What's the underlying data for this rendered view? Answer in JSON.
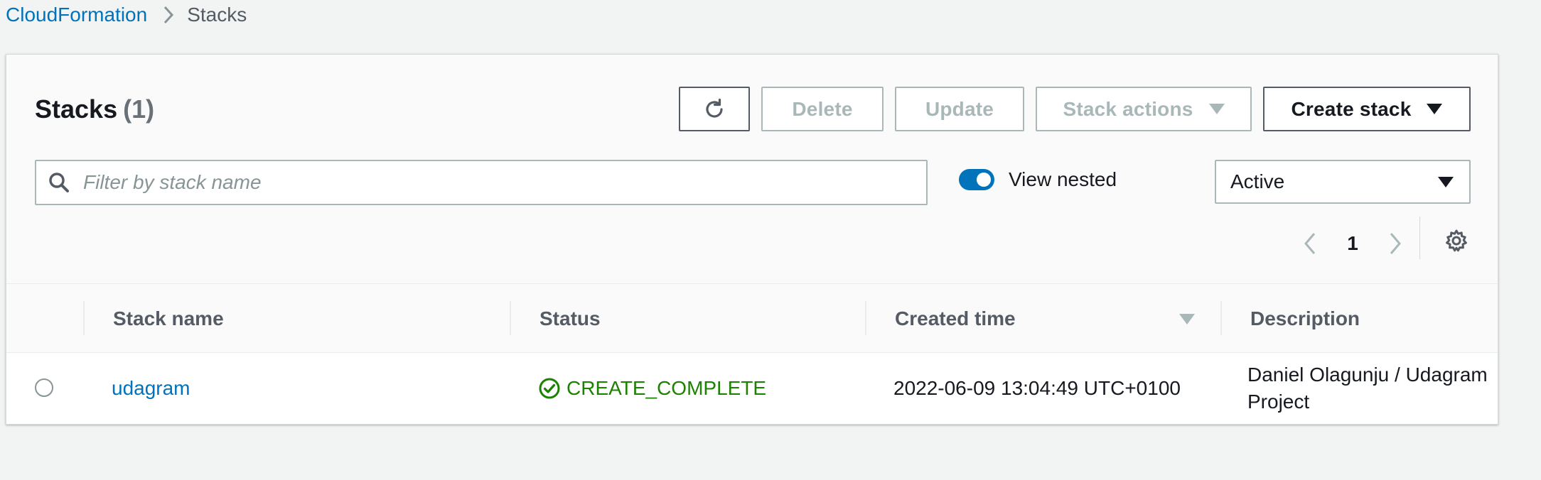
{
  "breadcrumb": {
    "root": "CloudFormation",
    "current": "Stacks"
  },
  "panel": {
    "title": "Stacks",
    "count": "(1)"
  },
  "toolbar": {
    "delete_label": "Delete",
    "update_label": "Update",
    "stack_actions_label": "Stack actions",
    "create_stack_label": "Create stack"
  },
  "filter": {
    "placeholder": "Filter by stack name",
    "view_nested_label": "View nested",
    "view_nested_on": true,
    "status_filter": "Active"
  },
  "pagination": {
    "current_page": "1"
  },
  "table": {
    "columns": [
      "Stack name",
      "Status",
      "Created time",
      "Description"
    ],
    "rows": [
      {
        "stack_name": "udagram",
        "status": "CREATE_COMPLETE",
        "created_time": "2022-06-09 13:04:49 UTC+0100",
        "description_line1": "Daniel Olagunju / Udagram",
        "description_line2": "Project"
      }
    ]
  },
  "colors": {
    "link": "#0073bb",
    "success": "#1d8102",
    "disabled": "#aab7b8",
    "toggle_on": "#0073bb"
  },
  "icons": {
    "refresh": "refresh-icon",
    "search": "search-icon",
    "settings": "gear-icon",
    "status": "check-circle-icon"
  }
}
